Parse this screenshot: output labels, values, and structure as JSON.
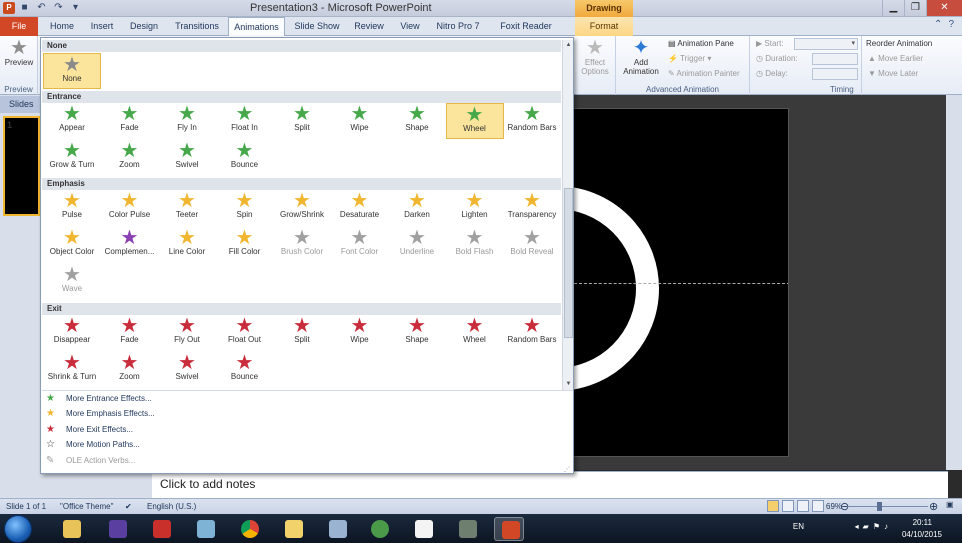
{
  "window": {
    "title": "Presentation3 - Microsoft PowerPoint",
    "drawing_tools": "Drawing Tools"
  },
  "tabs": {
    "file": "File",
    "home": "Home",
    "insert": "Insert",
    "design": "Design",
    "transitions": "Transitions",
    "animations": "Animations",
    "slideshow": "Slide Show",
    "review": "Review",
    "view": "View",
    "nitro": "Nitro Pro 7",
    "foxit": "Foxit Reader PDF",
    "format": "Format"
  },
  "ribbon": {
    "preview": "Preview",
    "preview_group": "Preview",
    "effect_options": "Effect",
    "effect_options2": "Options",
    "add_animation": "Add",
    "add_animation2": "Animation",
    "animation_pane": "Animation Pane",
    "trigger": "Trigger",
    "animation_painter": "Animation Painter",
    "advanced_group": "Advanced Animation",
    "start": "Start:",
    "duration": "Duration:",
    "delay": "Delay:",
    "timing_group": "Timing",
    "reorder": "Reorder Animation",
    "move_earlier": "Move Earlier",
    "move_later": "Move Later"
  },
  "slides_pane": {
    "tab": "Slides",
    "slide_number": "1"
  },
  "gallery": {
    "none_header": "None",
    "none_item": "None",
    "entrance_header": "Entrance",
    "entrance": [
      "Appear",
      "Fade",
      "Fly In",
      "Float In",
      "Split",
      "Wipe",
      "Shape",
      "Wheel",
      "Random Bars",
      "Grow & Turn",
      "Zoom",
      "Swivel",
      "Bounce"
    ],
    "emphasis_header": "Emphasis",
    "emphasis": [
      "Pulse",
      "Color Pulse",
      "Teeter",
      "Spin",
      "Grow/Shrink",
      "Desaturate",
      "Darken",
      "Lighten",
      "Transparency",
      "Object Color",
      "Complemen...",
      "Line Color",
      "Fill Color",
      "Brush Color",
      "Font Color",
      "Underline",
      "Bold Flash",
      "Bold Reveal",
      "Wave"
    ],
    "exit_header": "Exit",
    "exit": [
      "Disappear",
      "Fade",
      "Fly Out",
      "Float Out",
      "Split",
      "Wipe",
      "Shape",
      "Wheel",
      "Random Bars",
      "Shrink & Turn",
      "Zoom",
      "Swivel",
      "Bounce"
    ],
    "more_entrance": "More Entrance Effects...",
    "more_emphasis": "More Emphasis Effects...",
    "more_exit": "More Exit Effects...",
    "more_motion": "More Motion Paths...",
    "ole_verbs": "OLE Action Verbs..."
  },
  "notes": {
    "placeholder": "Click to add notes"
  },
  "status": {
    "slide": "Slide 1 of 1",
    "theme": "\"Office Theme\"",
    "language": "English (U.S.)",
    "zoom": "69%"
  },
  "taskbar": {
    "lang": "EN",
    "time": "20:11",
    "date": "04/10/2015"
  },
  "colors": {
    "file_tab": "#d24726",
    "selected_item": "#fbe49b",
    "entrance": "#46a84a",
    "emphasis": "#f0b62f",
    "exit": "#c92c3a"
  }
}
